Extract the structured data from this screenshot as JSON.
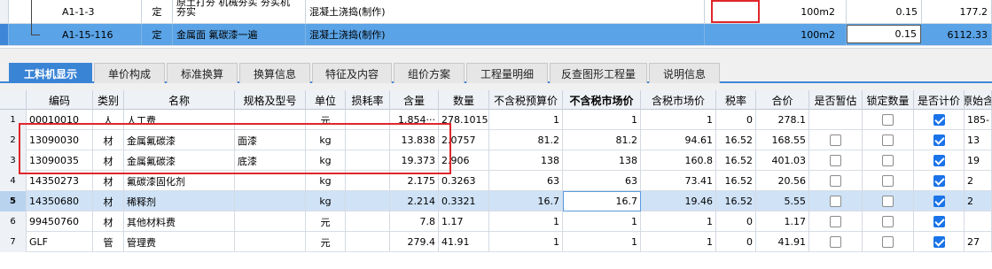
{
  "top_rows": [
    {
      "code": "A1-1-3",
      "type": "定",
      "name_line1": "原土打夯 机械夯实 夯实机",
      "name_line2": "夯实",
      "category": "混凝土浇捣(制作)",
      "unit": "100m2",
      "quantity": "0.15",
      "amount": "177.2"
    },
    {
      "code": "A1-15-116",
      "type": "定",
      "name": "金属面 氟碳漆一遍",
      "category": "混凝土浇捣(制作)",
      "unit": "100m2",
      "quantity": "0.15",
      "amount": "6112.33"
    }
  ],
  "tabs": [
    {
      "label": "工料机显示",
      "active": true
    },
    {
      "label": "单价构成"
    },
    {
      "label": "标准换算"
    },
    {
      "label": "换算信息"
    },
    {
      "label": "特征及内容"
    },
    {
      "label": "组价方案"
    },
    {
      "label": "工程量明细"
    },
    {
      "label": "反查图形工程量"
    },
    {
      "label": "说明信息"
    }
  ],
  "grid": {
    "headers": [
      "编码",
      "类别",
      "名称",
      "规格及型号",
      "单位",
      "损耗率",
      "含量",
      "数量",
      "不含税预算价",
      "不含税市场价",
      "含税市场价",
      "税率",
      "合价",
      "是否暂估",
      "锁定数量",
      "是否计价",
      "原始含"
    ],
    "rows": [
      {
        "n": "1",
        "code": "00010010",
        "type": "人",
        "name": "人工费",
        "spec": "",
        "unit": "元",
        "loss": "",
        "content": "1.854···",
        "qty": "278.1015",
        "pre": "1",
        "mkt": "1",
        "tmkt": "1",
        "tax": "0",
        "total": "278.1",
        "est": "",
        "lock": false,
        "calc": true,
        "orig": "185-"
      },
      {
        "n": "2",
        "code": "13090030",
        "type": "材",
        "name": "金属氟碳漆",
        "spec": "面漆",
        "unit": "kg",
        "loss": "",
        "content": "13.838",
        "qty": "2.0757",
        "pre": "81.2",
        "mkt": "81.2",
        "tmkt": "94.61",
        "tax": "16.52",
        "total": "168.55",
        "est": false,
        "lock": false,
        "calc": true,
        "orig": "13"
      },
      {
        "n": "3",
        "code": "13090035",
        "type": "材",
        "name": "金属氟碳漆",
        "spec": "底漆",
        "unit": "kg",
        "loss": "",
        "content": "19.373",
        "qty": "2.906",
        "pre": "138",
        "mkt": "138",
        "tmkt": "160.8",
        "tax": "16.52",
        "total": "401.03",
        "est": false,
        "lock": false,
        "calc": true,
        "orig": "19"
      },
      {
        "n": "4",
        "code": "14350273",
        "type": "材",
        "name": "氟碳漆固化剂",
        "spec": "",
        "unit": "kg",
        "loss": "",
        "content": "2.175",
        "qty": "0.3263",
        "pre": "63",
        "mkt": "63",
        "tmkt": "73.41",
        "tax": "16.52",
        "total": "20.56",
        "est": false,
        "lock": false,
        "calc": true,
        "orig": "2"
      },
      {
        "n": "5",
        "code": "14350680",
        "type": "材",
        "name": "稀释剂",
        "spec": "",
        "unit": "kg",
        "loss": "",
        "content": "2.214",
        "qty": "0.3321",
        "pre": "16.7",
        "mkt": "16.7",
        "tmkt": "19.46",
        "tax": "16.52",
        "total": "5.55",
        "est": false,
        "lock": false,
        "calc": true,
        "orig": "2"
      },
      {
        "n": "6",
        "code": "99450760",
        "type": "材",
        "name": "其他材料费",
        "spec": "",
        "unit": "元",
        "loss": "",
        "content": "7.8",
        "qty": "1.17",
        "pre": "1",
        "mkt": "1",
        "tmkt": "1",
        "tax": "0",
        "total": "1.17",
        "est": false,
        "lock": false,
        "calc": true,
        "orig": ""
      },
      {
        "n": "7",
        "code": "GLF",
        "type": "管",
        "name": "管理费",
        "spec": "",
        "unit": "元",
        "loss": "",
        "content": "279.4",
        "qty": "41.91",
        "pre": "1",
        "mkt": "1",
        "tmkt": "1",
        "tax": "0",
        "total": "41.91",
        "est": false,
        "lock": false,
        "calc": true,
        "orig": "27"
      }
    ]
  },
  "colors": {
    "accent": "#3a84d6",
    "selected_row": "#cfe2f6",
    "highlight_row": "#5aa3e6",
    "annotation": "#e0262b",
    "checkbox_on": "#1a73e8"
  }
}
